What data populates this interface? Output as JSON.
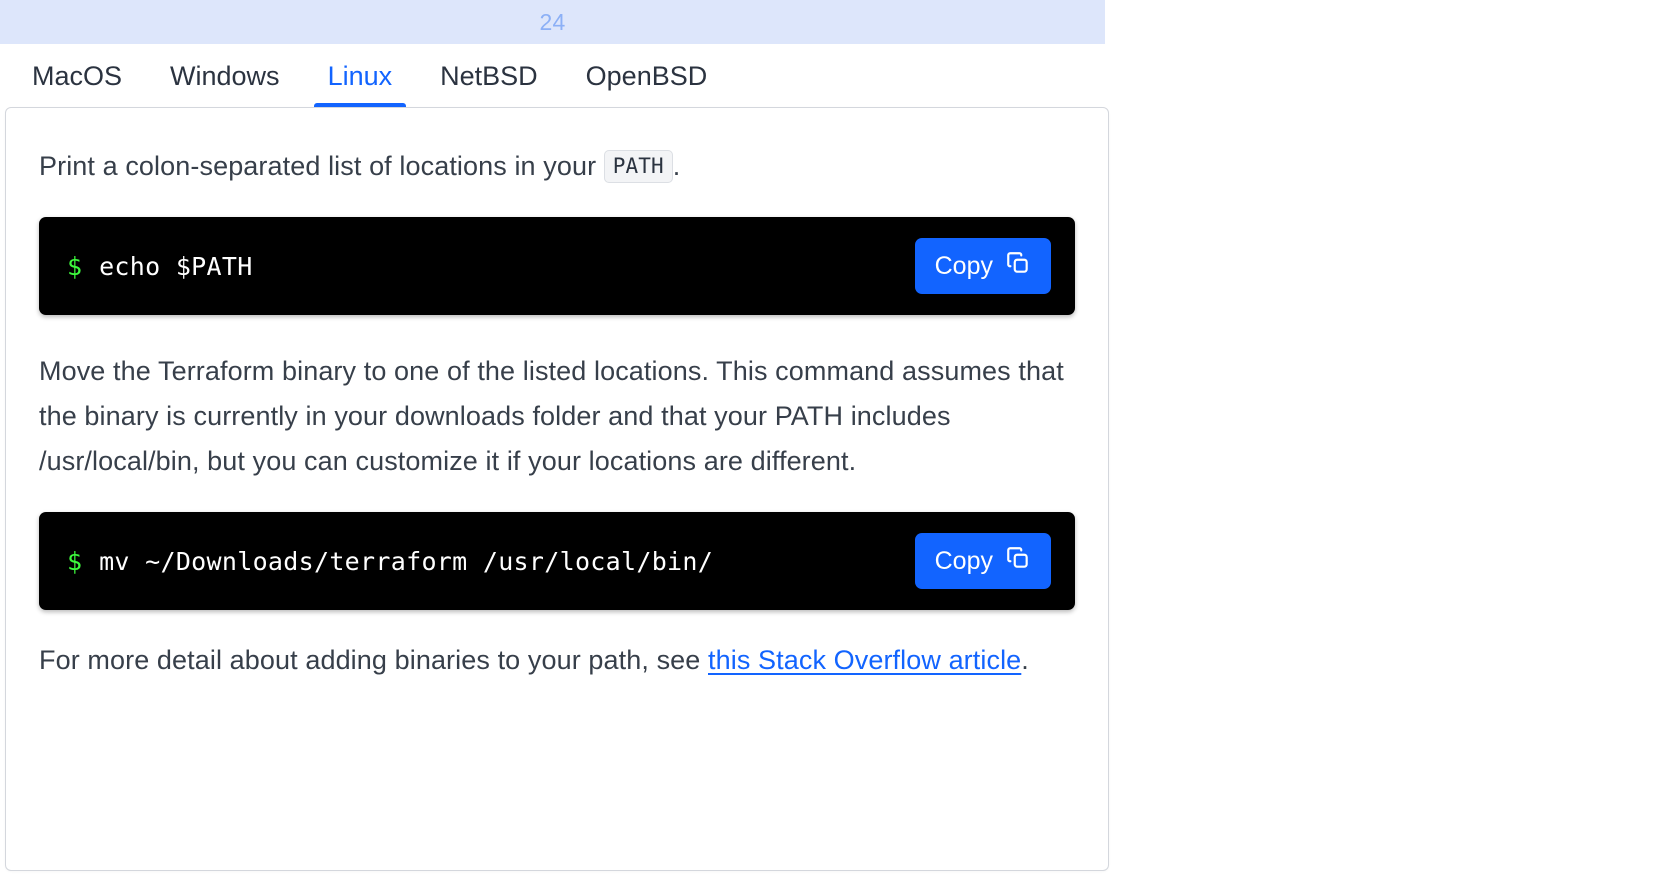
{
  "top_bar": {
    "count": "24"
  },
  "tabs": [
    {
      "label": "MacOS",
      "active": false
    },
    {
      "label": "Windows",
      "active": false
    },
    {
      "label": "Linux",
      "active": true
    },
    {
      "label": "NetBSD",
      "active": false
    },
    {
      "label": "OpenBSD",
      "active": false
    }
  ],
  "content": {
    "paragraph_1": {
      "before_code": "Print a colon-separated list of locations in your",
      "code": "PATH",
      "after_code": "."
    },
    "code_block_1": {
      "prompt": "$",
      "command": "echo $PATH",
      "copy_label": "Copy",
      "copy_icon": "copy-icon"
    },
    "paragraph_2": "Move the Terraform binary to one of the listed locations. This command assumes that the binary is currently in your downloads folder and that your PATH includes /usr/local/bin, but you can customize it if your locations are different.",
    "code_block_2": {
      "prompt": "$",
      "command": "mv ~/Downloads/terraform /usr/local/bin/",
      "copy_label": "Copy",
      "copy_icon": "copy-icon"
    },
    "paragraph_3": {
      "before_link": "For more detail about adding binaries to your path, see ",
      "link_text": "this Stack Overflow article",
      "after_link": "."
    }
  },
  "colors": {
    "accent_blue": "#1264ff",
    "top_bar_bg": "#dde6fb",
    "top_bar_text": "#8cb0f6",
    "terminal_bg": "#000000",
    "prompt_green": "#3dfa3d",
    "body_text": "#373f4a",
    "card_border": "#d4d7dd"
  }
}
